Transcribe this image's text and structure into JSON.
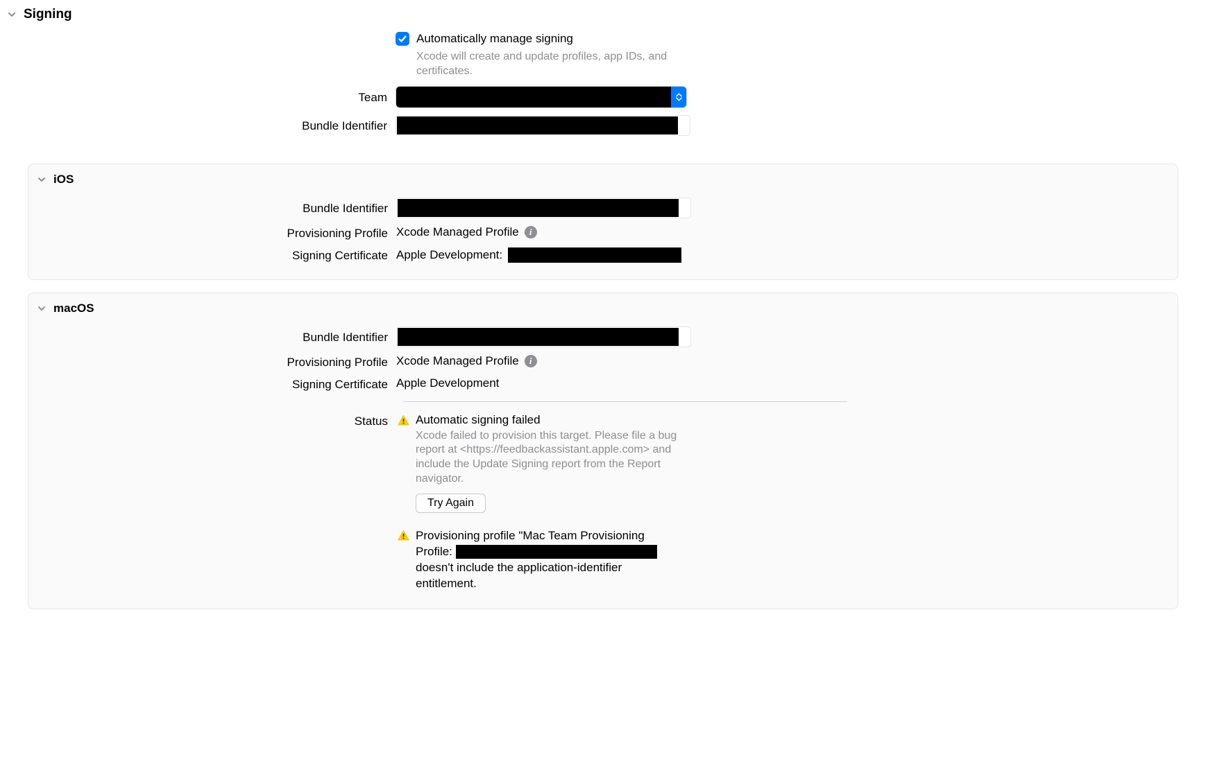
{
  "section": {
    "title": "Signing"
  },
  "autoSign": {
    "label": "Automatically manage signing",
    "description": "Xcode will create and update profiles, app IDs, and certificates."
  },
  "labels": {
    "team": "Team",
    "bundleIdentifier": "Bundle Identifier",
    "provisioningProfile": "Provisioning Profile",
    "signingCertificate": "Signing Certificate",
    "status": "Status"
  },
  "ios": {
    "title": "iOS",
    "provisioningProfile": "Xcode Managed Profile",
    "signingCertificatePrefix": "Apple Development: "
  },
  "macos": {
    "title": "macOS",
    "provisioningProfile": "Xcode Managed Profile",
    "signingCertificate": "Apple Development",
    "status": {
      "title": "Automatic signing failed",
      "description": "Xcode failed to provision this target. Please file a bug report at <https://feedbackassistant.apple.com> and include the Update Signing report from the Report navigator.",
      "tryAgain": "Try Again",
      "warning2a": "Provisioning profile \"Mac Team Provisioning Profile: ",
      "warning2b": " doesn't include the application-identifier entitlement."
    }
  }
}
